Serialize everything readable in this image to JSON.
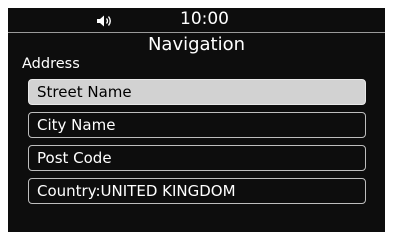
{
  "status": {
    "time": "10:00",
    "volume_icon": "speaker-volume-icon"
  },
  "header": {
    "title": "Navigation"
  },
  "section": {
    "label": "Address"
  },
  "items": [
    {
      "label": "Street Name",
      "selected": true
    },
    {
      "label": "City Name",
      "selected": false
    },
    {
      "label": "Post Code",
      "selected": false
    },
    {
      "label": "Country:UNITED KINGDOM",
      "selected": false
    }
  ],
  "colors": {
    "background": "#0d0d0d",
    "selected_fill": "#d2d2d2",
    "text": "#ffffff",
    "border": "#bdbdbd"
  }
}
